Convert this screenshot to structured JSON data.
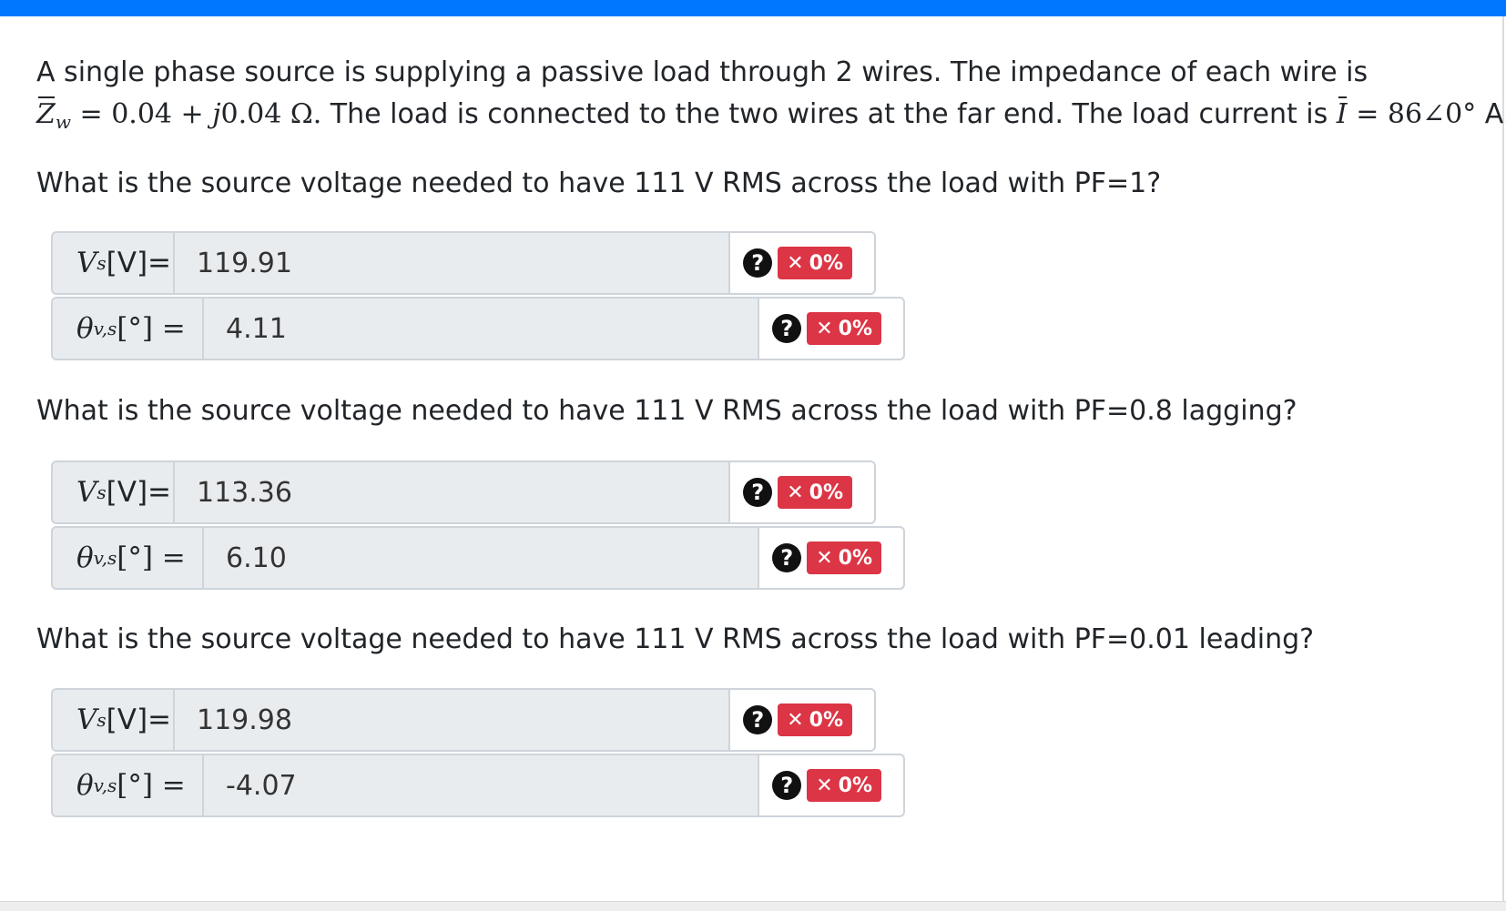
{
  "problem": {
    "line1": "A single phase source is supplying a passive load through 2 wires. The impedance of each wire is",
    "zw_symbol": "Z",
    "zw_sub": "w",
    "zw_eq": " = 0.04 + ",
    "zw_j": "j",
    "zw_value": "0.04 Ω.",
    "line2_mid": " The load is connected to the two wires at the far end. The load current is ",
    "i_symbol": "I",
    "i_eq": " = 86∠0°",
    "i_unit": " A."
  },
  "labels": {
    "v_symbol": "V",
    "v_sub": "s",
    "v_unit": "[V]=",
    "theta_symbol": "θ",
    "theta_sub": "v,s",
    "theta_unit": " [°] ="
  },
  "status": {
    "help": "?",
    "x": "✕",
    "score": "0%"
  },
  "questions": [
    {
      "text": "What is the source voltage needed to have 111 V RMS across the load with PF=1?",
      "voltage": "119.91",
      "angle": "4.11"
    },
    {
      "text": "What is the source voltage needed to have 111 V RMS across the load with PF=0.8 lagging?",
      "voltage": "113.36",
      "angle": "6.10"
    },
    {
      "text": "What is the source voltage needed to have 111 V RMS across the load with PF=0.01 leading?",
      "voltage": "119.98",
      "angle": "-4.07"
    }
  ],
  "colors": {
    "top_bar": "#0077ff",
    "badge": "#dc3545",
    "addon_bg": "#e9ecef"
  }
}
